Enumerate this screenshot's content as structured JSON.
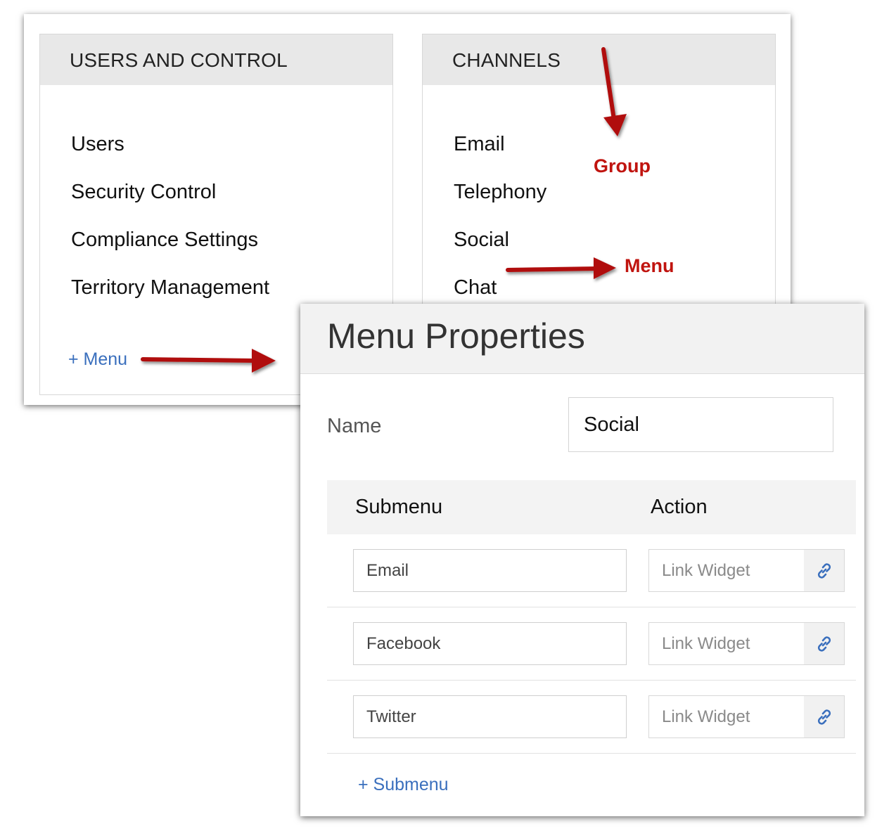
{
  "setup": {
    "groups": [
      {
        "title": "USERS AND CONTROL",
        "items": [
          "Users",
          "Security Control",
          "Compliance Settings",
          "Territory Management"
        ],
        "add_menu_label": "+ Menu"
      },
      {
        "title": "CHANNELS",
        "items": [
          "Email",
          "Telephony",
          "Social",
          "Chat"
        ]
      }
    ]
  },
  "annotations": {
    "group_label": "Group",
    "menu_label": "Menu",
    "color": "#c0140f"
  },
  "menu_properties": {
    "title": "Menu Properties",
    "name_label": "Name",
    "name_value": "Social",
    "columns": {
      "submenu": "Submenu",
      "action": "Action"
    },
    "rows": [
      {
        "submenu": "Email",
        "action_placeholder": "Link Widget",
        "icon": "link-icon"
      },
      {
        "submenu": "Facebook",
        "action_placeholder": "Link Widget",
        "icon": "link-icon"
      },
      {
        "submenu": "Twitter",
        "action_placeholder": "Link Widget",
        "icon": "link-icon"
      }
    ],
    "add_submenu_label": "+ Submenu"
  },
  "colors": {
    "accent_link": "#3a6fbd",
    "header_bg": "#e8e8e8",
    "annotation_red": "#c0140f"
  }
}
